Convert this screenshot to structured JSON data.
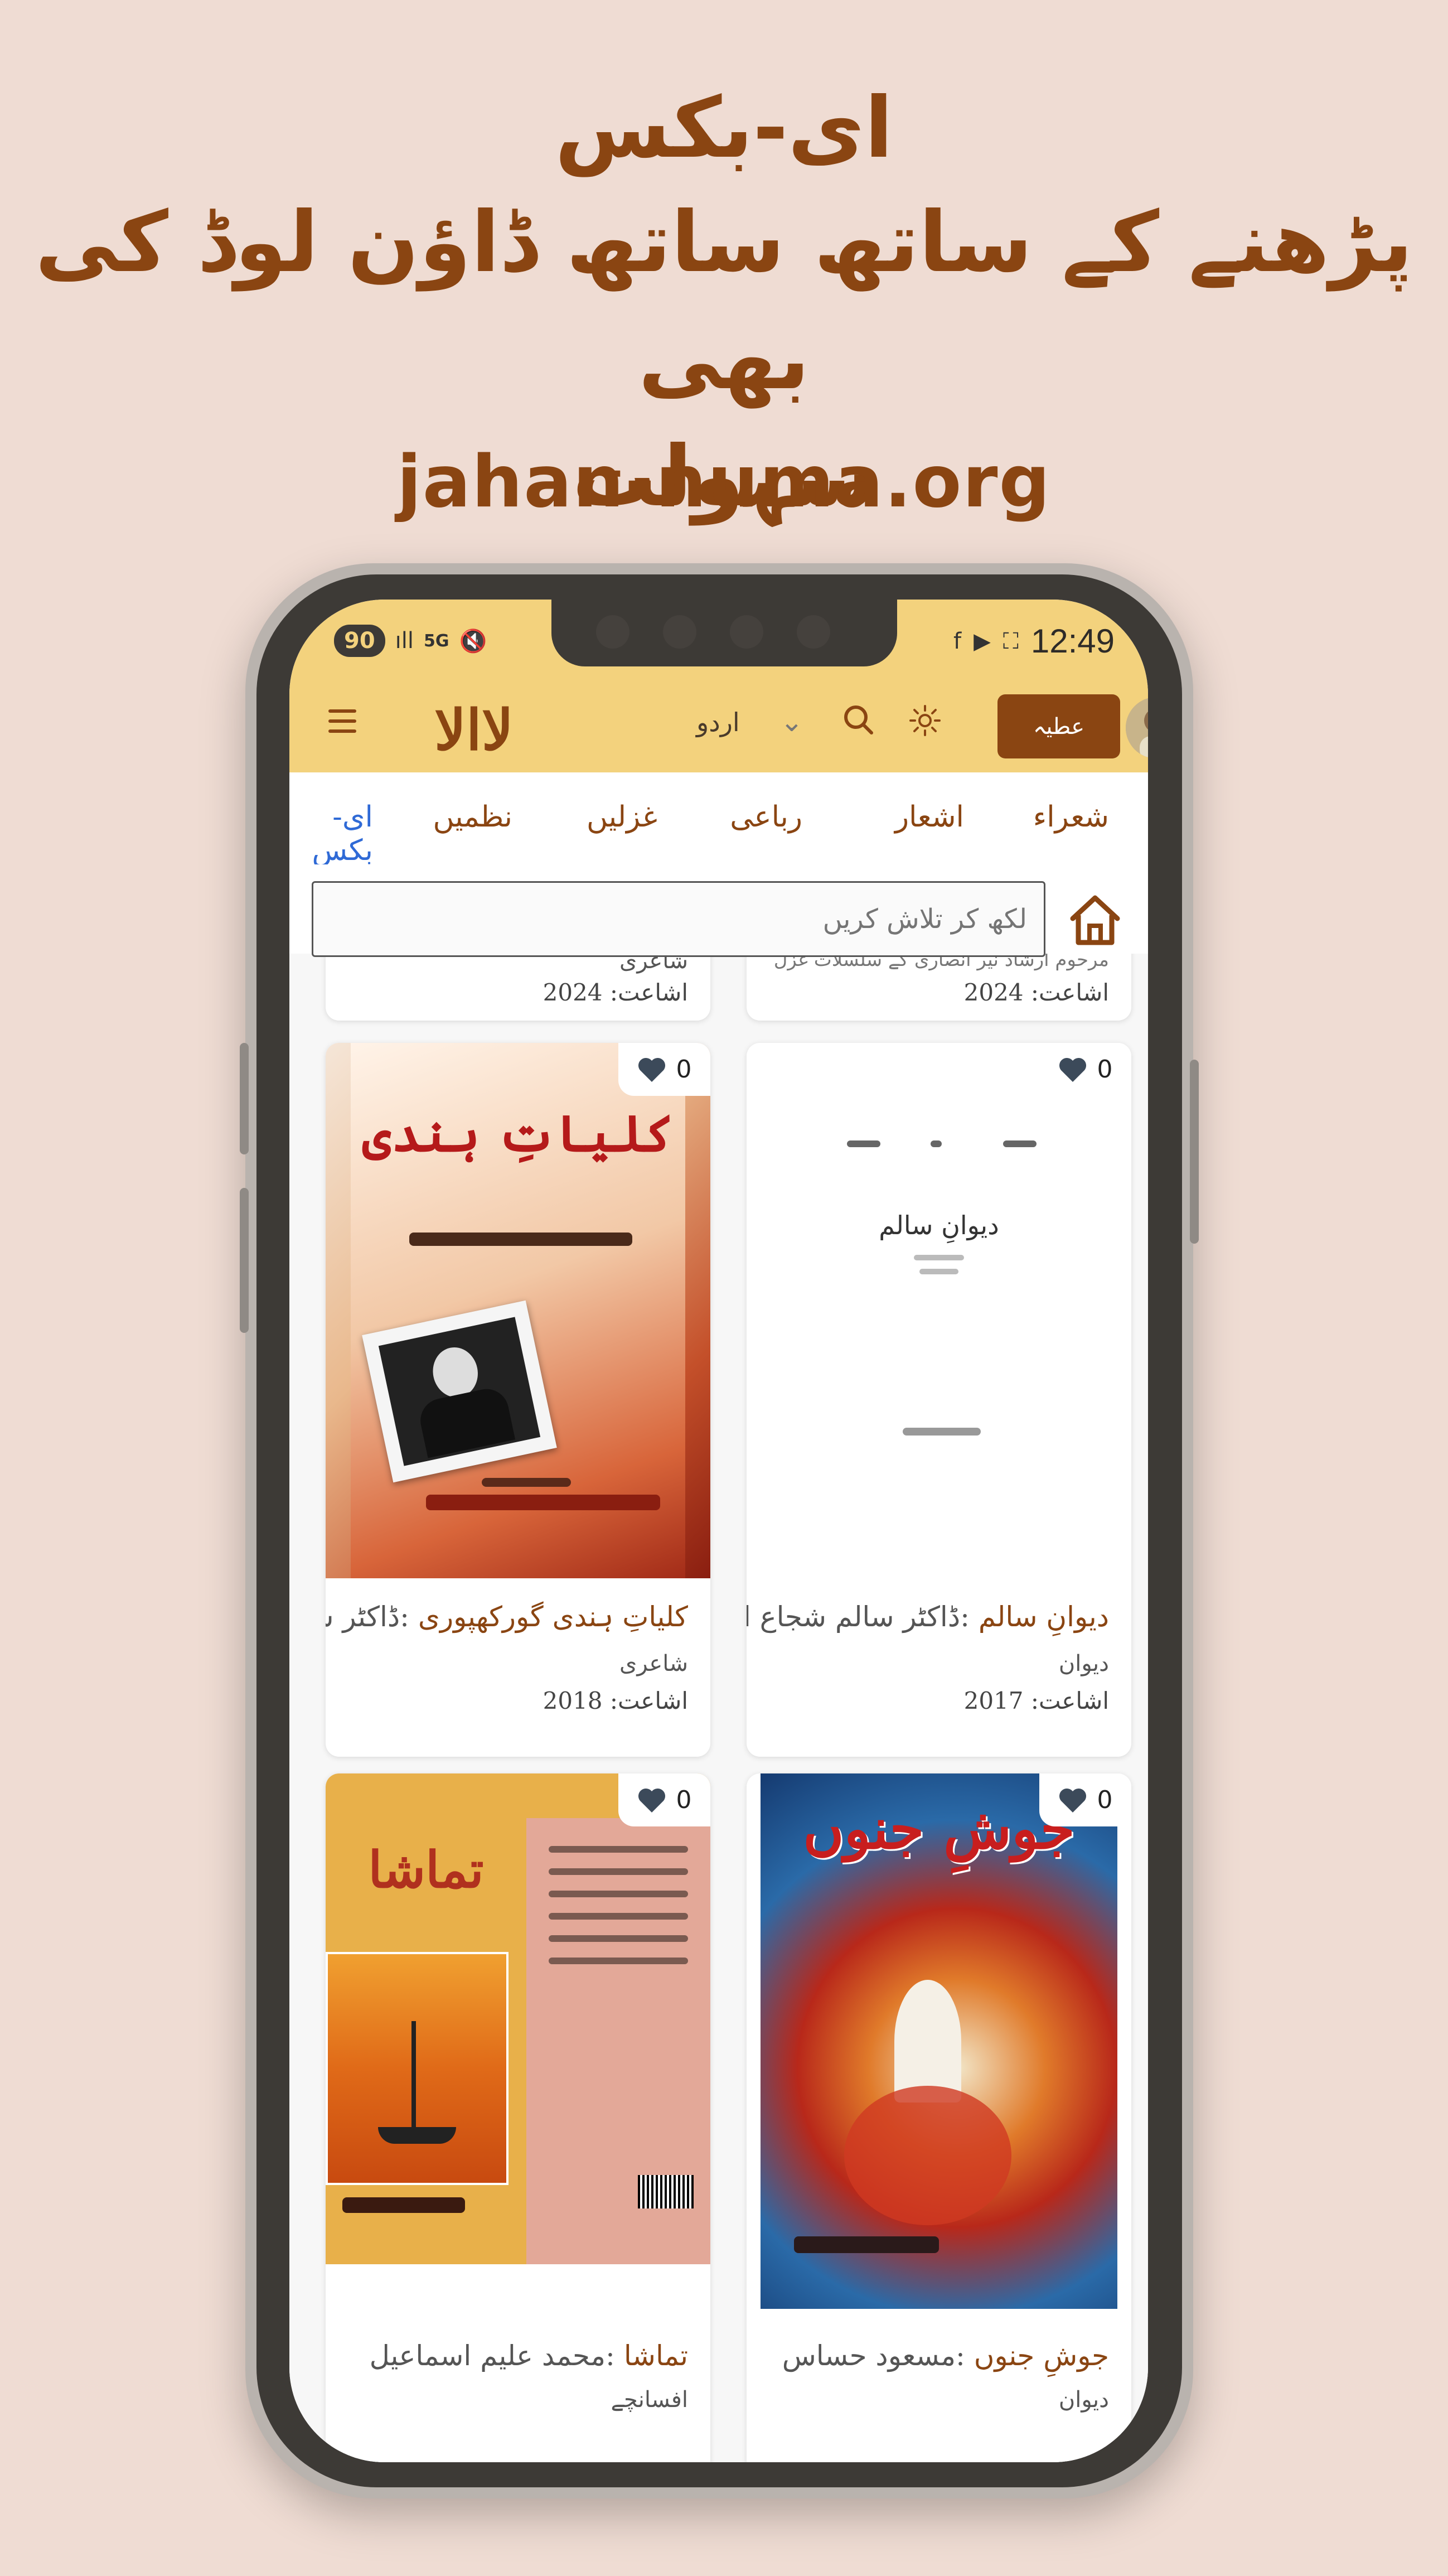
{
  "promo": {
    "line1": "ای-بکس",
    "line2": "پڑھنے کے ساتھ ساتھ ڈاؤن لوڈ کی بھی",
    "line3": "سہولت",
    "url": "jahan-numa.org"
  },
  "status_bar": {
    "battery": "90",
    "network": "5G",
    "time": "12:49"
  },
  "app_bar": {
    "logo_text": "لاالا",
    "language": "اردو",
    "donate_label": "عطیہ"
  },
  "tabs": [
    {
      "label": "شعراء"
    },
    {
      "label": "اشعار"
    },
    {
      "label": "رباعی"
    },
    {
      "label": "غزلیں"
    },
    {
      "label": "نظمیں"
    },
    {
      "label": "ای-بکس"
    }
  ],
  "search": {
    "placeholder": "لکھ کر تلاش کریں"
  },
  "top_cards": [
    {
      "genre": "شاعری",
      "year": "اشاعت: 2024"
    },
    {
      "subtitle": "مرحوم ارشاد نیر انصاری کے سلسلات غزل",
      "year": "اشاعت: 2024"
    }
  ],
  "books": [
    {
      "title": "دیوانِ سالم",
      "author": ":ڈاکٹر سالم شجاع انصاری",
      "genre": "دیوان",
      "year": "اشاعت: 2017",
      "likes": "0",
      "cover_text": "دیوانِ سالم"
    },
    {
      "title": "کلیاتِ ہندی گورکھپوری",
      "author": ":ڈاکٹر سلیم…",
      "genre": "شاعری",
      "year": "اشاعت: 2018",
      "likes": "0",
      "cover_text": "کلیاتِ ہندی"
    },
    {
      "title": "جوشِ جنوں",
      "author": ":مسعود حساس",
      "genre": "دیوان",
      "likes": "0",
      "cover_text": "جوشِ جنوں"
    },
    {
      "title": "تماشا",
      "author": ":محمد علیم اسماعیل",
      "genre": "افسانچے",
      "likes": "0",
      "cover_text": "تماشا"
    }
  ],
  "colors": {
    "accent": "#8a4512",
    "header_bg": "#f3d27d",
    "page_bg": "#efdcd3",
    "active_tab": "#2f6ad6"
  }
}
